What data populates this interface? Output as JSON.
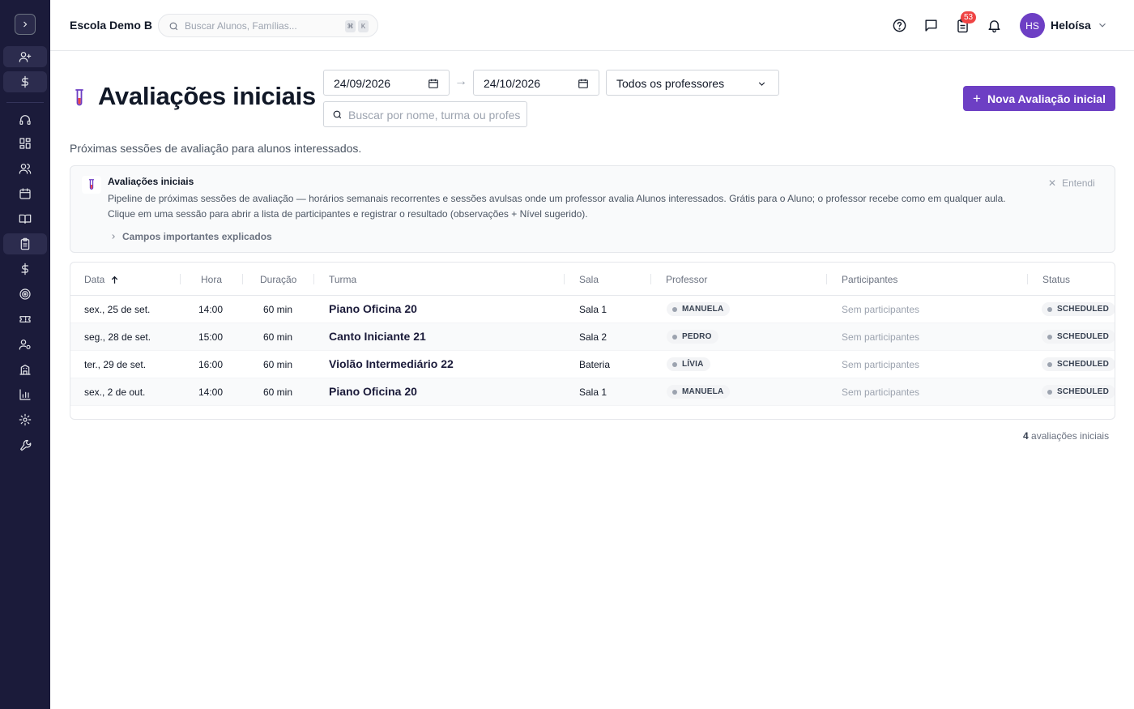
{
  "header": {
    "school_name": "Escola Demo B",
    "search_placeholder": "Buscar Alunos, Famílias...",
    "kbd_mod": "⌘",
    "kbd_key": "K",
    "notification_count": "53",
    "user_initials": "HS",
    "user_name": "Heloísa"
  },
  "sidebar": {
    "items": [
      "add-user-icon",
      "dollar-icon",
      "headset-icon",
      "dashboard-icon",
      "users-icon",
      "calendar-icon",
      "book-icon",
      "clipboard-icon",
      "dollar-icon",
      "target-icon",
      "ticket-icon",
      "user-settings-icon",
      "building-icon",
      "chart-icon",
      "gear-icon",
      "wrench-icon"
    ],
    "active": "clipboard-icon"
  },
  "page": {
    "title": "Avaliações iniciais",
    "date_from": "24/09/2026",
    "date_to": "24/10/2026",
    "arrow": "→",
    "professor_filter": "Todos os professores",
    "list_search_placeholder": "Buscar por nome, turma ou professor",
    "new_button": "Nova Avaliação inicial",
    "subtitle": "Próximas sessões de avaliação para alunos interessados."
  },
  "info": {
    "title": "Avaliações iniciais",
    "text": "Pipeline de próximas sessões de avaliação — horários semanais recorrentes e sessões avulsas onde um professor avalia Alunos interessados. Grátis para o Aluno; o professor recebe como em qualquer aula. Clique em uma sessão para abrir a lista de participantes e registrar o resultado (observações + Nível sugerido).",
    "fields_link": "Campos importantes explicados",
    "dismiss": "Entendi"
  },
  "table": {
    "columns": {
      "date": "Data",
      "time": "Hora",
      "duration": "Duração",
      "class": "Turma",
      "room": "Sala",
      "teacher": "Professor",
      "participants": "Participantes",
      "status": "Status"
    },
    "rows": [
      {
        "date": "sex., 25 de set.",
        "time": "14:00",
        "duration": "60 min",
        "class": "Piano Oficina 20",
        "room": "Sala 1",
        "teacher": "MANUELA",
        "participants": "Sem participantes",
        "status": "SCHEDULED"
      },
      {
        "date": "seg., 28 de set.",
        "time": "15:00",
        "duration": "60 min",
        "class": "Canto Iniciante 21",
        "room": "Sala 2",
        "teacher": "PEDRO",
        "participants": "Sem participantes",
        "status": "SCHEDULED"
      },
      {
        "date": "ter., 29 de set.",
        "time": "16:00",
        "duration": "60 min",
        "class": "Violão Intermediário 22",
        "room": "Bateria",
        "teacher": "LÍVIA",
        "participants": "Sem participantes",
        "status": "SCHEDULED"
      },
      {
        "date": "sex., 2 de out.",
        "time": "14:00",
        "duration": "60 min",
        "class": "Piano Oficina 20",
        "room": "Sala 1",
        "teacher": "MANUELA",
        "participants": "Sem participantes",
        "status": "SCHEDULED"
      }
    ]
  },
  "footer": {
    "count": "4",
    "count_label": "avaliações iniciais"
  },
  "colors": {
    "sidebar_bg": "#1b1b3a",
    "accent": "#6d3fc4",
    "badge": "#ef4444"
  }
}
